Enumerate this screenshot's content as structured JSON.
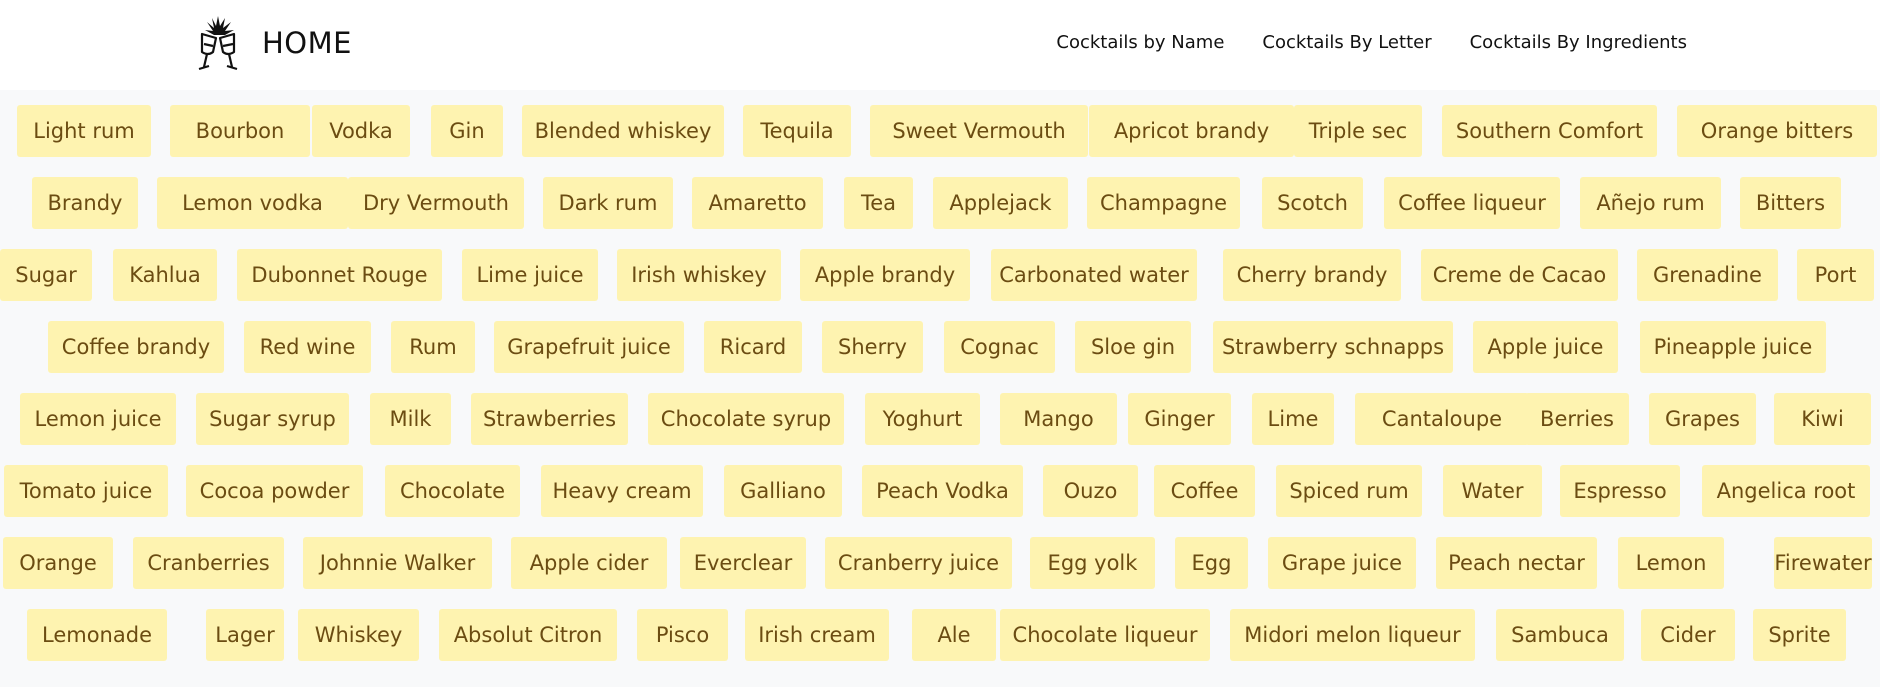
{
  "nav": {
    "brand": "HOME",
    "brand_icon": "cheers-glasses-icon",
    "links": [
      "Cocktails by Name",
      "Cocktails By Letter",
      "Cocktails By Ingredients"
    ]
  },
  "colors": {
    "chip_background": "#fef3b0",
    "chip_text": "#6b4c12",
    "page_background": "#f8f9fa",
    "navbar_background": "#ffffff"
  },
  "ingredient_rows": [
    [
      "Light rum",
      "Bourbon",
      "Vodka",
      "Gin",
      "Blended whiskey",
      "Tequila",
      "Sweet Vermouth",
      "Apricot brandy",
      "Triple sec",
      "Southern Comfort",
      "Orange bitters"
    ],
    [
      "Brandy",
      "Lemon vodka",
      "Dry Vermouth",
      "Dark rum",
      "Amaretto",
      "Tea",
      "Applejack",
      "Champagne",
      "Scotch",
      "Coffee liqueur",
      "Añejo rum",
      "Bitters"
    ],
    [
      "Sugar",
      "Kahlua",
      "Dubonnet Rouge",
      "Lime juice",
      "Irish whiskey",
      "Apple brandy",
      "Carbonated water",
      "Cherry brandy",
      "Creme de Cacao",
      "Grenadine",
      "Port"
    ],
    [
      "Coffee brandy",
      "Red wine",
      "Rum",
      "Grapefruit juice",
      "Ricard",
      "Sherry",
      "Cognac",
      "Sloe gin",
      "Strawberry schnapps",
      "Apple juice",
      "Pineapple juice"
    ],
    [
      "Lemon juice",
      "Sugar syrup",
      "Milk",
      "Strawberries",
      "Chocolate syrup",
      "Yoghurt",
      "Mango",
      "Ginger",
      "Lime",
      "Cantaloupe",
      "Berries",
      "Grapes",
      "Kiwi"
    ],
    [
      "Tomato juice",
      "Cocoa powder",
      "Chocolate",
      "Heavy cream",
      "Galliano",
      "Peach Vodka",
      "Ouzo",
      "Coffee",
      "Spiced rum",
      "Water",
      "Espresso",
      "Angelica root"
    ],
    [
      "Orange",
      "Cranberries",
      "Johnnie Walker",
      "Apple cider",
      "Everclear",
      "Cranberry juice",
      "Egg yolk",
      "Egg",
      "Grape juice",
      "Peach nectar",
      "Lemon",
      "Firewater"
    ],
    [
      "Lemonade",
      "Lager",
      "Whiskey",
      "Absolut Citron",
      "Pisco",
      "Irish cream",
      "Ale",
      "Chocolate liqueur",
      "Midori melon liqueur",
      "Sambuca",
      "Cider",
      "Sprite"
    ]
  ]
}
